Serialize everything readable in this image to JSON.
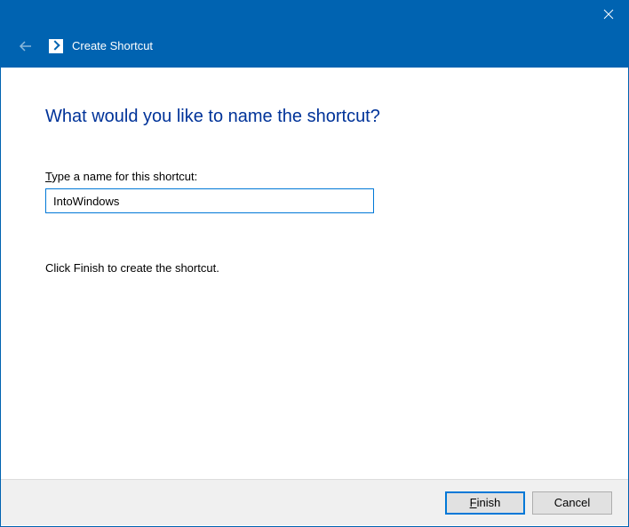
{
  "titlebar": {
    "wizard_title": "Create Shortcut"
  },
  "content": {
    "heading": "What would you like to name the shortcut?",
    "input_label_prefix": "T",
    "input_label_rest": "ype a name for this shortcut:",
    "input_value": "IntoWindows",
    "instruction": "Click Finish to create the shortcut."
  },
  "footer": {
    "finish_prefix": "F",
    "finish_rest": "inish",
    "cancel_label": "Cancel"
  }
}
